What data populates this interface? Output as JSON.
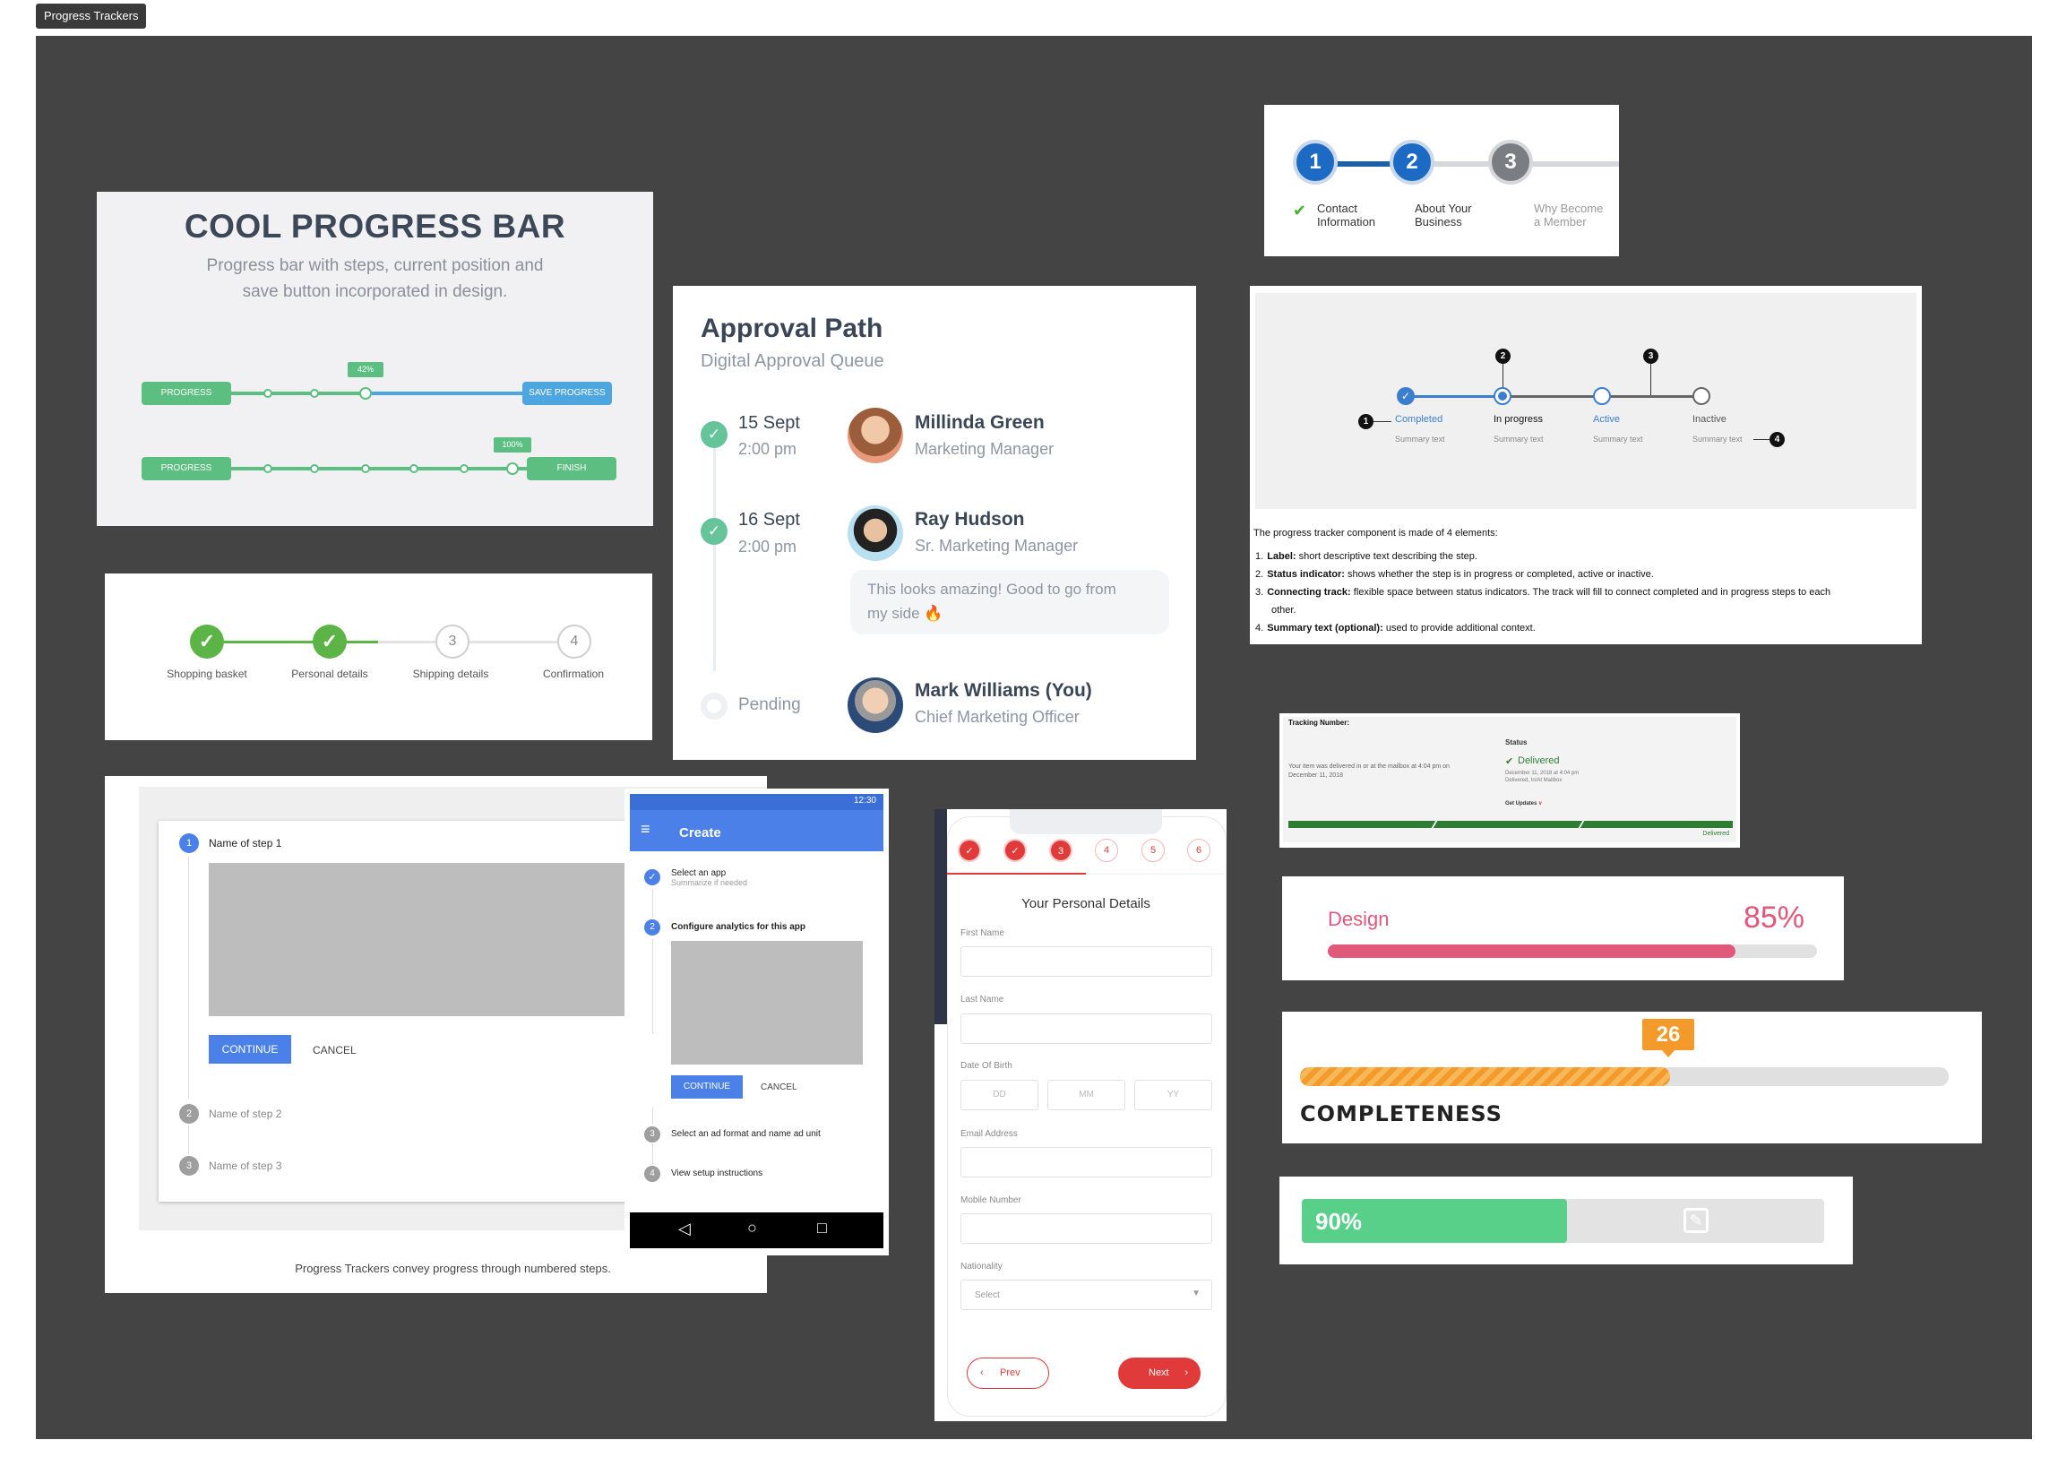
{
  "frame": {
    "tag": "Progress Trackers"
  },
  "cool_progress": {
    "title": "COOL PROGRESS BAR",
    "subtitle_line1": "Progress bar with steps, current position and",
    "subtitle_line2": "save button incorporated in design.",
    "row1": {
      "start_label": "PROGRESS",
      "badge": "42%",
      "end_label": "SAVE PROGRESS",
      "value": 0.42
    },
    "row2": {
      "start_label": "PROGRESS",
      "badge": "100%",
      "end_label": "FINISH",
      "value": 1.0
    },
    "colors": {
      "green": "#5cbe81",
      "blue": "#4ea6e0"
    }
  },
  "shopping_stepper": {
    "steps": [
      {
        "label": "Shopping basket",
        "state": "done",
        "mark": "✓"
      },
      {
        "label": "Personal details",
        "state": "done",
        "mark": "✓"
      },
      {
        "label": "Shipping details",
        "state": "todo",
        "mark": "3"
      },
      {
        "label": "Confirmation",
        "state": "todo",
        "mark": "4"
      }
    ],
    "color": "#5db446"
  },
  "approval": {
    "title": "Approval Path",
    "subtitle": "Digital Approval Queue",
    "entries": [
      {
        "date": "15 Sept",
        "time": "2:00 pm",
        "name": "Millinda Green",
        "role": "Marketing Manager",
        "status": "done"
      },
      {
        "date": "16 Sept",
        "time": "2:00 pm",
        "name": "Ray Hudson",
        "role": "Sr. Marketing Manager",
        "status": "done",
        "comment_line1": "This looks amazing! Good to go from",
        "comment_line2": "my side 🔥"
      },
      {
        "date": "Pending",
        "name": "Mark Williams (You)",
        "role": "Chief Marketing Officer",
        "status": "pending"
      }
    ],
    "color": "#65c49a"
  },
  "member_stepper": {
    "steps": [
      {
        "num": "1",
        "line1": "Contact",
        "line2": "Information",
        "state": "done"
      },
      {
        "num": "2",
        "line1": "About Your",
        "line2": "Business",
        "state": "active"
      },
      {
        "num": "3",
        "line1": "Why Become",
        "line2": "a Member",
        "state": "inactive"
      }
    ],
    "check": "✔"
  },
  "tracker_doc": {
    "steps": [
      {
        "label": "Completed",
        "summary": "Summary text"
      },
      {
        "label": "In progress",
        "summary": "Summary text"
      },
      {
        "label": "Active",
        "summary": "Summary text"
      },
      {
        "label": "Inactive",
        "summary": "Summary text"
      }
    ],
    "markers": [
      "1",
      "2",
      "3",
      "4"
    ],
    "intro": "The progress tracker component is made of 4 elements:",
    "items": [
      {
        "n": "1.",
        "term": "Label:",
        "text": " short descriptive text describing the step."
      },
      {
        "n": "2.",
        "term": "Status indicator:",
        "text": " shows whether the step is in progress or completed, active or inactive."
      },
      {
        "n": "3.",
        "term": "Connecting track:",
        "text": " flexible space between status indicators. The track will fill to connect completed and in progress steps to each"
      },
      {
        "n": "",
        "term": "",
        "text": "other."
      },
      {
        "n": "4.",
        "term": "Summary text (optional):",
        "text": " used to provide additional context."
      }
    ],
    "color": "#3b7ed0"
  },
  "material_stepper": {
    "steps": [
      {
        "num": "1",
        "label": "Name of step 1",
        "active": true
      },
      {
        "num": "2",
        "label": "Name of step 2",
        "active": false
      },
      {
        "num": "3",
        "label": "Name of step 3",
        "active": false
      }
    ],
    "continue": "CONTINUE",
    "cancel": "CANCEL",
    "caption": "Progress Trackers convey progress through numbered steps."
  },
  "android_stepper": {
    "time": "12:30",
    "title": "Create",
    "steps": [
      {
        "mark": "✓",
        "label": "Select an app",
        "sub": "Summarize if needed",
        "state": "done"
      },
      {
        "mark": "2",
        "label": "Configure analytics for this app",
        "sub": "",
        "state": "active"
      },
      {
        "mark": "3",
        "label": "Select an ad format and name ad unit",
        "sub": "",
        "state": "todo"
      },
      {
        "mark": "4",
        "label": "View setup instructions",
        "sub": "",
        "state": "todo"
      }
    ],
    "continue": "CONTINUE",
    "cancel": "CANCEL",
    "nav": {
      "back": "◁",
      "home": "○",
      "recent": "□"
    }
  },
  "mobile_form": {
    "steps": [
      "✓",
      "✓",
      "3",
      "4",
      "5",
      "6"
    ],
    "title": "Your Personal Details",
    "fields": {
      "first_name": "First Name",
      "last_name": "Last Name",
      "dob": "Date Of Birth",
      "dd": "DD",
      "mm": "MM",
      "yy": "YY",
      "email": "Email Address",
      "mobile": "Mobile Number",
      "nationality": "Nationality",
      "select": "Select"
    },
    "prev": "Prev",
    "next": "Next",
    "color": "#e03a3a"
  },
  "shipping": {
    "tracking_label": "Tracking Number:",
    "status_label": "Status",
    "message_line1": "Your item was delivered in or at the mailbox at 4:04 pm on",
    "message_line2": "December 11, 2018",
    "delivered": "Delivered",
    "date_line1": "December 11, 2018 at 4:04 pm",
    "date_line2": "Delivered, In/At Mailbox",
    "updates": "Get Updates",
    "bar_label": "Delivered",
    "color": "#2e7d32"
  },
  "design_bar": {
    "label": "Design",
    "percent": "85%",
    "value": 0.85,
    "color": "#e0587a"
  },
  "completeness_bar": {
    "badge": "26",
    "label": "COMPLETENESS",
    "value": 0.57,
    "color": "#f39a2a"
  },
  "ninety_bar": {
    "label": "90%",
    "value": 0.9,
    "color": "#58d08a"
  }
}
